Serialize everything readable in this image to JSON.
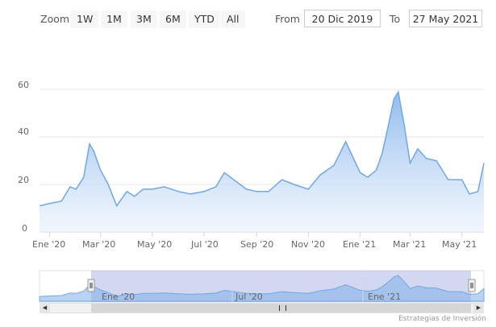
{
  "range_selector": {
    "zoom_label": "Zoom",
    "buttons": [
      "1W",
      "1M",
      "3M",
      "6M",
      "YTD",
      "All"
    ],
    "from_label": "From",
    "from_value": "20 Dic 2019",
    "to_label": "To",
    "to_value": "27 May 2021"
  },
  "chart_data": {
    "type": "area",
    "ylim": [
      0,
      60
    ],
    "yticks": [
      "0",
      "20",
      "40",
      "60"
    ],
    "xticks": [
      "Ene '20",
      "Mar '20",
      "May '20",
      "Jul '20",
      "Sep '20",
      "Nov '20",
      "Ene '21",
      "Mar '21",
      "May '21"
    ],
    "x": [
      "2019-12-20",
      "2020-01-01",
      "2020-01-15",
      "2020-01-25",
      "2020-02-01",
      "2020-02-10",
      "2020-02-17",
      "2020-02-22",
      "2020-03-01",
      "2020-03-10",
      "2020-03-20",
      "2020-04-01",
      "2020-04-10",
      "2020-04-20",
      "2020-05-01",
      "2020-05-15",
      "2020-06-01",
      "2020-06-15",
      "2020-07-01",
      "2020-07-15",
      "2020-07-25",
      "2020-08-05",
      "2020-08-20",
      "2020-09-01",
      "2020-09-15",
      "2020-10-01",
      "2020-10-15",
      "2020-11-01",
      "2020-11-15",
      "2020-12-01",
      "2020-12-15",
      "2021-01-01",
      "2021-01-10",
      "2021-01-20",
      "2021-01-27",
      "2021-02-01",
      "2021-02-10",
      "2021-02-15",
      "2021-02-22",
      "2021-03-01",
      "2021-03-10",
      "2021-03-20",
      "2021-04-01",
      "2021-04-15",
      "2021-05-01",
      "2021-05-10",
      "2021-05-20",
      "2021-05-27"
    ],
    "values": [
      11,
      12,
      13,
      19,
      18,
      23,
      37,
      34,
      26,
      20,
      11,
      17,
      15,
      18,
      18,
      19,
      17,
      16,
      17,
      19,
      25,
      22,
      18,
      17,
      17,
      22,
      20,
      18,
      24,
      28,
      38,
      25,
      23,
      26,
      33,
      41,
      56,
      59,
      45,
      29,
      35,
      31,
      30,
      22,
      22,
      16,
      17,
      29
    ],
    "navigator_labels": [
      "Ene '20",
      "Jul '20",
      "Ene '21"
    ],
    "line_color": "#6fa8e6",
    "fill_color": "#a8c8f0"
  },
  "credit": "Estrategias de Inversión"
}
